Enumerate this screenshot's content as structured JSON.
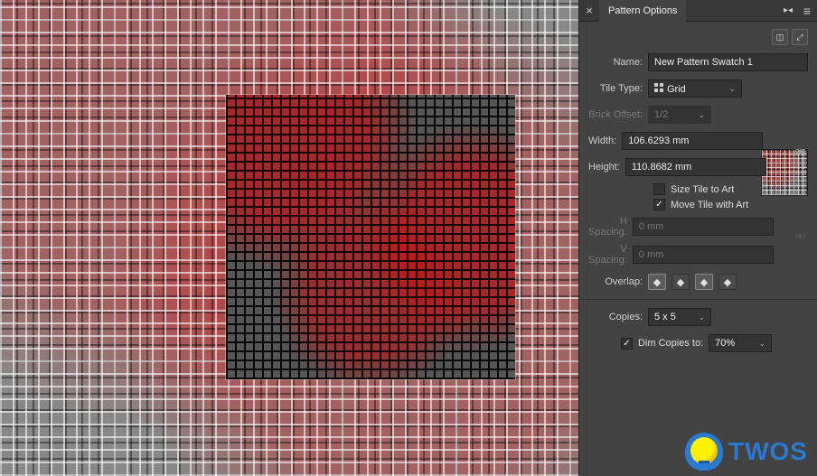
{
  "panel": {
    "title": "Pattern Options",
    "name": {
      "label": "Name:",
      "value": "New Pattern Swatch 1"
    },
    "tile_type": {
      "label": "Tile Type:",
      "value": "Grid"
    },
    "brick_offset": {
      "label": "Brick Offset:",
      "value": "1/2",
      "enabled": false
    },
    "width": {
      "label": "Width:",
      "value": "106.6293 mm"
    },
    "height": {
      "label": "Height:",
      "value": "110.8682 mm"
    },
    "size_tile_to_art": {
      "label": "Size Tile to Art",
      "checked": false
    },
    "move_tile_with_art": {
      "label": "Move Tile with Art",
      "checked": true
    },
    "h_spacing": {
      "label": "H Spacing:",
      "value": "0 mm",
      "enabled": false
    },
    "v_spacing": {
      "label": "V Spacing:",
      "value": "0 mm",
      "enabled": false
    },
    "overlap": {
      "label": "Overlap:"
    },
    "copies": {
      "label": "Copies:",
      "value": "5 x 5"
    },
    "dim_copies": {
      "label": "Dim Copies to:",
      "value": "70%",
      "checked": true
    }
  },
  "logo": {
    "text": "TWOS"
  }
}
